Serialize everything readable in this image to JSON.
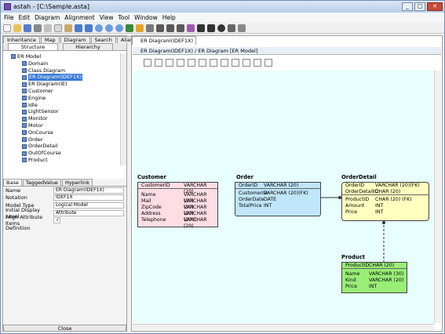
{
  "window": {
    "title": "astah - [C:\\Sample.asta]",
    "minimize": "_",
    "maximize": "□",
    "close": "✕"
  },
  "menu": [
    "File",
    "Edit",
    "Diagram",
    "Alignment",
    "View",
    "Tool",
    "Window",
    "Help"
  ],
  "left_tabs_row1": [
    "Inheritance",
    "Map",
    "Diagram",
    "Search",
    "Alias"
  ],
  "left_tabs_row2": [
    "Structure",
    "Hierarchy"
  ],
  "tree": [
    {
      "label": "ER Model",
      "indent": 1
    },
    {
      "label": "Domain",
      "indent": 2
    },
    {
      "label": "Class Diagram",
      "indent": 2
    },
    {
      "label": "ER Diagram(IDEF1X)",
      "indent": 2,
      "selected": true
    },
    {
      "label": "ER Diagram(IE)",
      "indent": 2
    },
    {
      "label": "Customer",
      "indent": 2
    },
    {
      "label": "Engine",
      "indent": 2
    },
    {
      "label": "Idle",
      "indent": 2
    },
    {
      "label": "LightSensor",
      "indent": 2
    },
    {
      "label": "Monitor",
      "indent": 2
    },
    {
      "label": "Motor",
      "indent": 2
    },
    {
      "label": "OnCourse",
      "indent": 2
    },
    {
      "label": "Order",
      "indent": 2
    },
    {
      "label": "OrderDetail",
      "indent": 2
    },
    {
      "label": "OutOfCourse",
      "indent": 2
    },
    {
      "label": "Product",
      "indent": 2
    }
  ],
  "prop_tabs": [
    "Base",
    "TaggedValue",
    "Hyperlink"
  ],
  "props": [
    {
      "label": "Name",
      "value": "ER Diagram(IDEF1X)"
    },
    {
      "label": "Notation",
      "value": "IDEF1X"
    },
    {
      "label": "Model Type",
      "value": "Logical Model"
    },
    {
      "label": "Initial Display Level",
      "value": "Attribute"
    },
    {
      "label": "Align Attribute Items",
      "value": "✓"
    },
    {
      "label": "Definition",
      "value": ""
    }
  ],
  "close_label": "Close",
  "diagram_tab": "ER Diagram(IDEF1X)",
  "diagram_header": "ER Diagram(IDEF1X) / ER Diagram [ER Model]",
  "entities": {
    "customer": {
      "name": "Customer",
      "color": "#ffdde4",
      "pk": [
        [
          "CustomerID",
          "VARCHAR (20)"
        ]
      ],
      "attrs": [
        [
          "Name",
          "VARCHAR (30)"
        ],
        [
          "Mail",
          "VARCHAR (50)"
        ],
        [
          "ZipCode",
          "VARCHAR (20)"
        ],
        [
          "Address",
          "VARCHAR (200)"
        ],
        [
          "Telephone",
          "VARCHAR (20)"
        ]
      ]
    },
    "order": {
      "name": "Order",
      "color": "#bfe6fb",
      "pk": [
        [
          "OrderID",
          "VARCHAR (20)"
        ]
      ],
      "attrs": [
        [
          "CustomerID",
          "VARCHAR (20)(FK)"
        ],
        [
          "OrderDate",
          "DATE"
        ],
        [
          "TotalPrice",
          "INT"
        ]
      ]
    },
    "orderdetail": {
      "name": "OrderDetail",
      "color": "#ffffc0",
      "pk": [
        [
          "OrderID",
          "VARCHAR (20)(FK)"
        ],
        [
          "OrderDetailID",
          "CHAR (20)"
        ]
      ],
      "attrs": [
        [
          "ProductID",
          "CHAR (20)      (FK)"
        ],
        [
          "Amount",
          "INT"
        ],
        [
          "Price",
          "INT"
        ]
      ]
    },
    "product": {
      "name": "Product",
      "color": "#99ee77",
      "pk": [
        [
          "ProductID",
          "CHAR (20)"
        ]
      ],
      "attrs": [
        [
          "Name",
          "VARCHAR (30)"
        ],
        [
          "Kind",
          "VARCHAR (20)"
        ],
        [
          "Price",
          "INT"
        ]
      ]
    }
  }
}
